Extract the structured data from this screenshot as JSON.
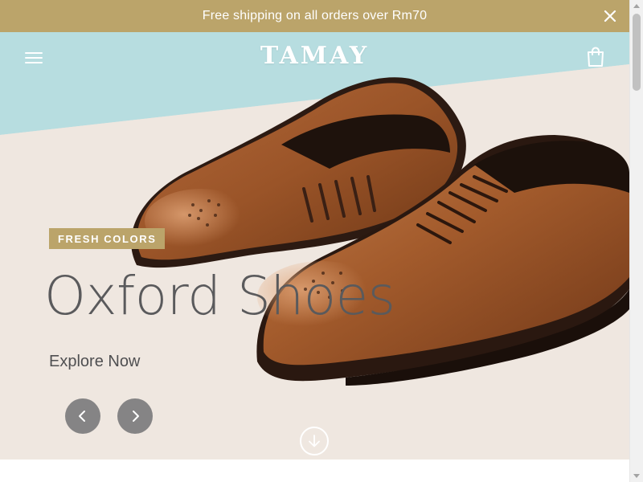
{
  "announcement": {
    "text": "Free shipping on all orders over Rm70"
  },
  "header": {
    "logo": "TAMAY",
    "menu_icon": "hamburger-menu-icon",
    "cart_icon": "shopping-bag-icon"
  },
  "hero": {
    "badge": "FRESH COLORS",
    "headline": "Oxford Shoes",
    "cta": "Explore Now",
    "prev_icon": "chevron-left-icon",
    "next_icon": "chevron-right-icon",
    "scroll_icon": "arrow-down-icon"
  },
  "colors": {
    "accent": "#bba46a",
    "headline": "#5a5a5c",
    "nav_button": "#6e6e70"
  }
}
